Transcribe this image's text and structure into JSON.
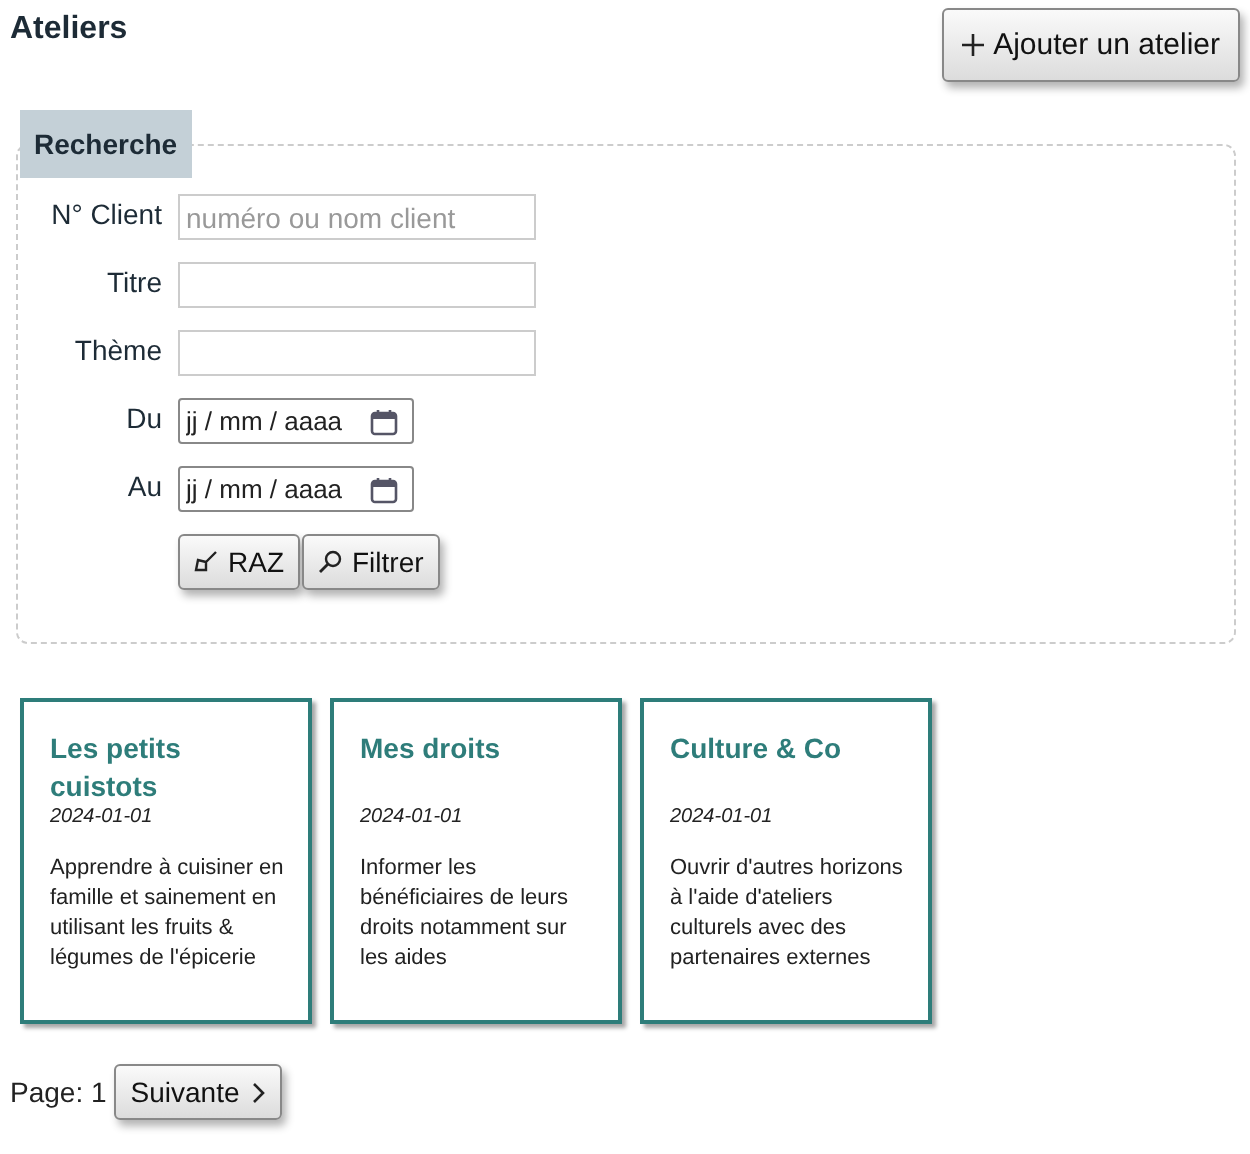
{
  "page": {
    "title": "Ateliers",
    "add_button": "Ajouter un atelier"
  },
  "search": {
    "legend": "Recherche",
    "fields": [
      {
        "kind": "text",
        "label": "N° Client",
        "placeholder": "numéro ou nom client"
      },
      {
        "kind": "text",
        "label": "Titre"
      },
      {
        "kind": "text",
        "label": "Thème"
      },
      {
        "kind": "date",
        "label": "Du",
        "placeholder": "jj / mm / aaaa"
      },
      {
        "kind": "date",
        "label": "Au",
        "placeholder": "jj / mm / aaaa"
      }
    ],
    "buttons": [
      {
        "kind": "reset",
        "label": "RAZ"
      },
      {
        "kind": "filter",
        "label": "Filtrer"
      }
    ]
  },
  "cards": [
    {
      "title": "Les petits cuistots",
      "date": "2024-01-01",
      "description": "Apprendre à cuisiner en famille et sainement en utilisant les fruits & légumes de l'épicerie"
    },
    {
      "title": "Mes droits",
      "date": "2024-01-01",
      "description": "Informer les bénéficiaires de leurs droits notamment sur les aides"
    },
    {
      "title": "Culture & Co",
      "date": "2024-01-01",
      "description": "Ouvrir d'autres horizons à l'aide d'ateliers culturels avec des partenaires externes"
    }
  ],
  "pagination": {
    "label": "Page: 1",
    "next_button": "Suivante"
  }
}
